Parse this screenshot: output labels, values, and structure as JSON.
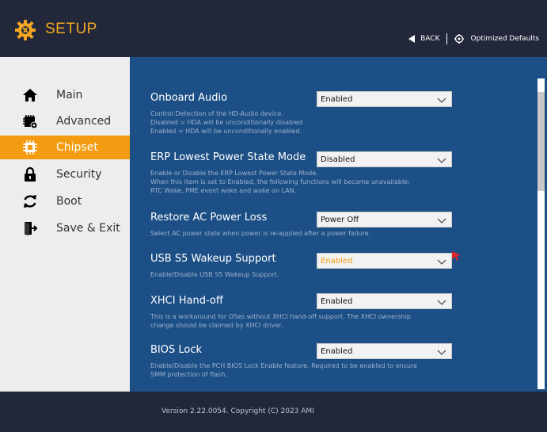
{
  "header": {
    "title": "SETUP",
    "back_label": "BACK",
    "optimized_label": "Optimized Defaults",
    "logo_icon": "gear-wrench-icon",
    "accent_color": "#f4a623"
  },
  "sidebar": {
    "items": [
      {
        "label": "Main",
        "icon": "home-icon",
        "active": false
      },
      {
        "label": "Advanced",
        "icon": "chip-settings-icon",
        "active": false
      },
      {
        "label": "Chipset",
        "icon": "chip-icon",
        "active": true
      },
      {
        "label": "Security",
        "icon": "lock-icon",
        "active": false
      },
      {
        "label": "Boot",
        "icon": "refresh-icon",
        "active": false
      },
      {
        "label": "Save & Exit",
        "icon": "exit-door-icon",
        "active": false
      }
    ],
    "active_color": "#f39c12"
  },
  "settings": [
    {
      "name": "Onboard Audio",
      "value": "Enabled",
      "desc": [
        "Control Detection of the HD-Audio device.",
        "Disabled = HDA will be unconditionally disabled",
        "Enabled = HDA will be unconditionally enabled."
      ]
    },
    {
      "name": "ERP Lowest Power State Mode",
      "value": "Disabled",
      "desc": [
        "Enable or Disable the ERP Lowest Power State Mode.",
        "When this item is set to Enabled, the following functions will become unavailable:",
        "RTC Wake, PME event wake and wake on LAN."
      ]
    },
    {
      "name": "Restore AC Power Loss",
      "value": "Power Off",
      "desc": [
        "Select AC power state when power is re-applied after a power failure."
      ]
    },
    {
      "name": "USB S5 Wakeup Support",
      "value": "Enabled",
      "desc": [
        "Enable/Disable USB S5 Wakeup Support."
      ]
    },
    {
      "name": "XHCI Hand-off",
      "value": "Enabled",
      "desc": [
        "This is a workaround for OSes without XHCI hand-off support. The XHCI ownership",
        "change should be claimed by XHCI driver."
      ]
    },
    {
      "name": "BIOS Lock",
      "value": "Enabled",
      "desc": [
        "Enable/Disable the PCH BIOS Lock Enable feature. Required to be enabled to ensure",
        "SMM protection of flash."
      ]
    }
  ],
  "footer": {
    "version": "Version 2.22.0054. Copyright (C) 2023 AMI"
  }
}
